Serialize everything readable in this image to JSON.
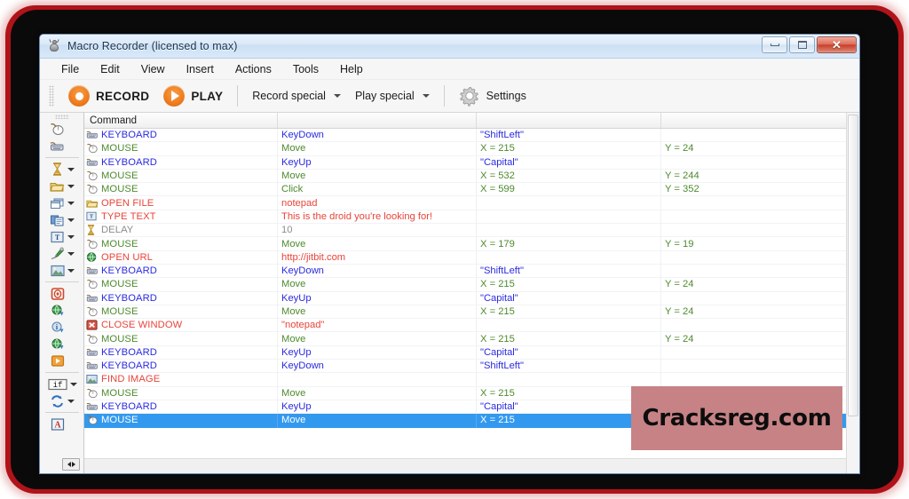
{
  "window": {
    "title": "Macro Recorder (licensed to max)",
    "icon": "bug-icon",
    "controls": {
      "minimize": "minimize-button",
      "maximize": "maximize-button",
      "close": "close-button"
    }
  },
  "menubar": {
    "items": [
      {
        "label": "File"
      },
      {
        "label": "Edit"
      },
      {
        "label": "View"
      },
      {
        "label": "Insert"
      },
      {
        "label": "Actions"
      },
      {
        "label": "Tools"
      },
      {
        "label": "Help"
      }
    ]
  },
  "toolbar": {
    "record_label": "RECORD",
    "play_label": "PLAY",
    "record_special_label": "Record special",
    "play_special_label": "Play special",
    "settings_label": "Settings"
  },
  "sidebar": {
    "items": [
      {
        "name": "mouse-tool",
        "dropdown": false
      },
      {
        "name": "keyboard-tool",
        "dropdown": false
      },
      {
        "name": "delay-tool",
        "dropdown": true
      },
      {
        "name": "open-file-tool",
        "dropdown": true
      },
      {
        "name": "window-tool",
        "dropdown": true
      },
      {
        "name": "clipboard-tool",
        "dropdown": true
      },
      {
        "name": "type-text-tool",
        "dropdown": true
      },
      {
        "name": "color-picker-tool",
        "dropdown": true
      },
      {
        "name": "find-image-tool",
        "dropdown": true
      },
      {
        "name": "record-region-tool",
        "dropdown": false
      },
      {
        "name": "open-url-tool",
        "dropdown": false
      },
      {
        "name": "info-tool",
        "dropdown": false
      },
      {
        "name": "web-tool",
        "dropdown": false
      },
      {
        "name": "run-tool",
        "dropdown": false
      },
      {
        "name": "if-condition-tool",
        "label": "if",
        "dropdown": true
      },
      {
        "name": "loop-tool",
        "dropdown": true
      },
      {
        "name": "text-variable-tool",
        "dropdown": false
      }
    ],
    "scroll_label": "scroll-horizontal"
  },
  "grid": {
    "headers": [
      "Command",
      "",
      "",
      ""
    ],
    "rows": [
      {
        "icon": "keyboard-icon",
        "command": "KEYBOARD",
        "color": "#2a2ae0",
        "p1": "KeyDown",
        "p2": "\"ShiftLeft\"",
        "p3": "",
        "selected": false
      },
      {
        "icon": "mouse-icon",
        "command": "MOUSE",
        "color": "#4d8a2e",
        "p1": "Move",
        "p2": "X = 215",
        "p3": "Y = 24",
        "selected": false
      },
      {
        "icon": "keyboard-icon",
        "command": "KEYBOARD",
        "color": "#2a2ae0",
        "p1": "KeyUp",
        "p2": "\"Capital\"",
        "p3": "",
        "selected": false
      },
      {
        "icon": "mouse-icon",
        "command": "MOUSE",
        "color": "#4d8a2e",
        "p1": "Move",
        "p2": "X = 532",
        "p3": "Y = 244",
        "selected": false
      },
      {
        "icon": "mouse-icon",
        "command": "MOUSE",
        "color": "#4d8a2e",
        "p1": "Click",
        "p2": "X = 599",
        "p3": "Y = 352",
        "selected": false
      },
      {
        "icon": "open-file-icon",
        "command": "OPEN FILE",
        "color": "#e8443a",
        "p1": "notepad",
        "p2": "",
        "p3": "",
        "selected": false
      },
      {
        "icon": "type-text-icon",
        "command": "TYPE TEXT",
        "color": "#e8443a",
        "p1": "This is the droid you're looking for!",
        "p2": "",
        "p3": "",
        "selected": false
      },
      {
        "icon": "delay-icon",
        "command": "DELAY",
        "color": "#8c8c8c",
        "p1": "10",
        "p2": "",
        "p3": "",
        "selected": false
      },
      {
        "icon": "mouse-icon",
        "command": "MOUSE",
        "color": "#4d8a2e",
        "p1": "Move",
        "p2": "X = 179",
        "p3": "Y = 19",
        "selected": false
      },
      {
        "icon": "open-url-icon",
        "command": "OPEN URL",
        "color": "#e8443a",
        "p1": "http://jitbit.com",
        "p2": "",
        "p3": "",
        "selected": false
      },
      {
        "icon": "keyboard-icon",
        "command": "KEYBOARD",
        "color": "#2a2ae0",
        "p1": "KeyDown",
        "p2": "\"ShiftLeft\"",
        "p3": "",
        "selected": false
      },
      {
        "icon": "mouse-icon",
        "command": "MOUSE",
        "color": "#4d8a2e",
        "p1": "Move",
        "p2": "X = 215",
        "p3": "Y = 24",
        "selected": false
      },
      {
        "icon": "keyboard-icon",
        "command": "KEYBOARD",
        "color": "#2a2ae0",
        "p1": "KeyUp",
        "p2": "\"Capital\"",
        "p3": "",
        "selected": false
      },
      {
        "icon": "mouse-icon",
        "command": "MOUSE",
        "color": "#4d8a2e",
        "p1": "Move",
        "p2": "X = 215",
        "p3": "Y = 24",
        "selected": false
      },
      {
        "icon": "close-window-icon",
        "command": "CLOSE WINDOW",
        "color": "#e8443a",
        "p1": "\"notepad\"",
        "p2": "",
        "p3": "",
        "selected": false
      },
      {
        "icon": "mouse-icon",
        "command": "MOUSE",
        "color": "#4d8a2e",
        "p1": "Move",
        "p2": "X = 215",
        "p3": "Y = 24",
        "selected": false
      },
      {
        "icon": "keyboard-icon",
        "command": "KEYBOARD",
        "color": "#2a2ae0",
        "p1": "KeyUp",
        "p2": "\"Capital\"",
        "p3": "",
        "selected": false
      },
      {
        "icon": "keyboard-icon",
        "command": "KEYBOARD",
        "color": "#2a2ae0",
        "p1": "KeyDown",
        "p2": "\"ShiftLeft\"",
        "p3": "",
        "selected": false
      },
      {
        "icon": "find-image-icon",
        "command": "FIND IMAGE",
        "color": "#e8443a",
        "p1": "",
        "p2": "",
        "p3": "",
        "selected": false
      },
      {
        "icon": "mouse-icon",
        "command": "MOUSE",
        "color": "#4d8a2e",
        "p1": "Move",
        "p2": "X = 215",
        "p3": "",
        "selected": false
      },
      {
        "icon": "keyboard-icon",
        "command": "KEYBOARD",
        "color": "#2a2ae0",
        "p1": "KeyUp",
        "p2": "\"Capital\"",
        "p3": "",
        "selected": false
      },
      {
        "icon": "mouse-icon",
        "command": "MOUSE",
        "color": "#4d8a2e",
        "p1": "Move",
        "p2": "X = 215",
        "p3": "",
        "selected": true
      }
    ]
  },
  "watermark": {
    "text": "Cracksreg.com",
    "bg": "#c68285"
  },
  "colors": {
    "accent_orange": "#ef7e20",
    "selection_blue": "#3399ef",
    "mouse_green": "#4d8a2e",
    "keyboard_blue": "#2a2ae0",
    "action_red": "#e8443a",
    "delay_gray": "#8c8c8c",
    "frame_red": "#b0131a"
  }
}
